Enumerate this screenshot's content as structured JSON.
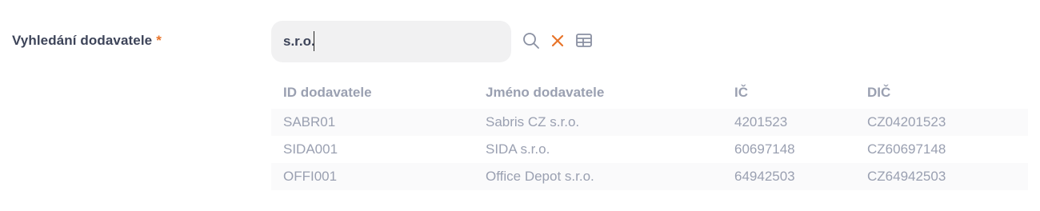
{
  "form": {
    "label": "Vyhledání dodavatele",
    "required_mark": "*",
    "search_value": "s.r.o."
  },
  "icons": {
    "search": "search-icon",
    "clear": "close-icon",
    "table": "table-icon"
  },
  "colors": {
    "required": "#e8742a",
    "clear_icon": "#e8742a",
    "icon": "#8a90a2",
    "input_bg": "#f1f1f2"
  },
  "results": {
    "headers": [
      "ID dodavatele",
      "Jméno dodavatele",
      "IČ",
      "DIČ"
    ],
    "rows": [
      [
        "SABR01",
        "Sabris CZ s.r.o.",
        "4201523",
        "CZ04201523"
      ],
      [
        "SIDA001",
        "SIDA s.r.o.",
        "60697148",
        "CZ60697148"
      ],
      [
        "OFFI001",
        "Office Depot s.r.o.",
        "64942503",
        "CZ64942503"
      ]
    ]
  }
}
